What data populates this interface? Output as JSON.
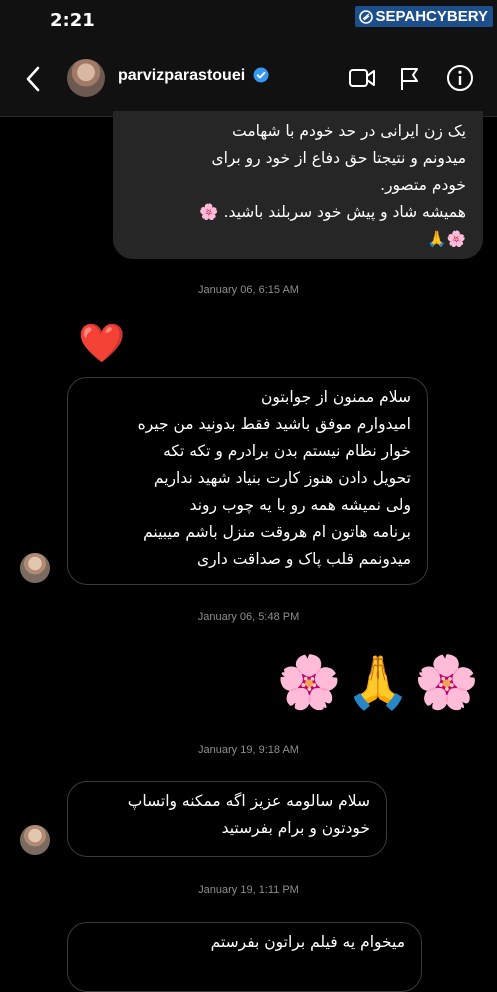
{
  "status_bar": {
    "time": "2:21"
  },
  "watermark": {
    "text": "SEPAHCYBERY"
  },
  "header": {
    "username": "parvizparastouei"
  },
  "messages": [
    {
      "sender": "me",
      "lines": [
        "یک زن ایرانی در حد خودم با شهامت",
        "میدونم و نتیجتا حق دفاع از خود رو برای",
        "خودم متصور.",
        "همیشه شاد و پیش خود سربلند باشید. 🌸",
        "🌸🙏"
      ]
    },
    {
      "timestamp": "January 06, 6:15 AM"
    },
    {
      "sender": "them",
      "emoji": "❤️"
    },
    {
      "sender": "them",
      "lines": [
        "سلام ممنون از جوابتون",
        "امیدوارم موفق باشید فقط بدونید من جیره",
        "خوار نظام نیستم بدن برادرم و تکه تکه",
        "تحویل دادن هنوز کارت بنیاد شهید نداریم",
        "ولی نمیشه همه رو با یه چوب روند",
        "برنامه هاتون ام هروقت منزل باشم میبینم",
        "میدونمم قلب پاک و صداقت داری"
      ]
    },
    {
      "timestamp": "January 06, 5:48 PM"
    },
    {
      "sender": "me",
      "emoji": "🌸🙏🌸"
    },
    {
      "timestamp": "January 19, 9:18 AM"
    },
    {
      "sender": "them",
      "lines": [
        "سلام سالومه عزیز اگه ممکنه  واتساپ",
        "خودتون و برام بفرستید"
      ]
    },
    {
      "timestamp": "January 19, 1:11 PM"
    },
    {
      "sender": "them",
      "lines": [
        "میخوام یه فیلم براتون بفرستم"
      ]
    }
  ]
}
